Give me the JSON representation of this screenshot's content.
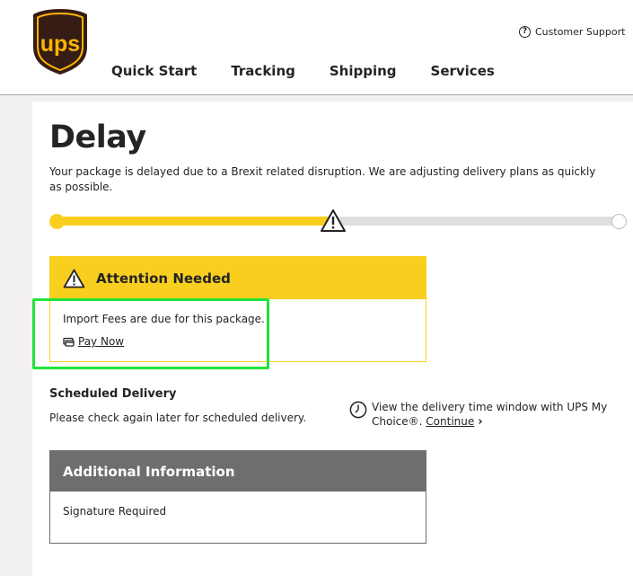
{
  "header": {
    "brand_text": "ups",
    "nav": [
      "Quick Start",
      "Tracking",
      "Shipping",
      "Services"
    ],
    "support_label": "Customer Support",
    "support_icon": "?"
  },
  "status": {
    "title": "Delay",
    "description": "Your package is delayed due to a Brexit related disruption. We are adjusting delivery plans as quickly as possible."
  },
  "progress": {
    "fraction": 0.49,
    "marker": "warning-icon"
  },
  "attention": {
    "title": "Attention Needed",
    "message": "Import Fees are due for this package.",
    "pay_label": "Pay Now"
  },
  "scheduled": {
    "title": "Scheduled Delivery",
    "text": "Please check again later for scheduled delivery.",
    "mychoice_text": "View the delivery time window with UPS My Choice®.",
    "continue_label": "Continue"
  },
  "additional": {
    "title": "Additional Information",
    "item": "Signature Required"
  },
  "colors": {
    "ups_brown": "#351c15",
    "ups_gold": "#ffb500",
    "accent_yellow": "#f9cf1f",
    "gray_header": "#6e6e6e",
    "highlight_green": "#22e43a"
  }
}
